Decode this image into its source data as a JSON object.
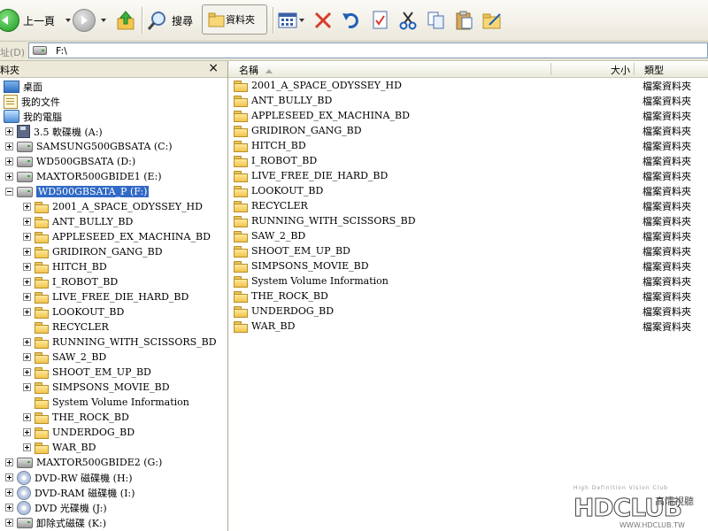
{
  "toolbar": {
    "back_label": "上一頁",
    "search_label": "搜尋",
    "folders_label": "資料夾"
  },
  "address": {
    "label": "址(D)",
    "value": "F:\\"
  },
  "folder_pane": {
    "title": "料夾",
    "close": "×",
    "items": [
      {
        "label": "桌面",
        "icon": "desktop-icon",
        "expander": "none"
      },
      {
        "label": "我的文件",
        "icon": "my-documents-icon",
        "expander": "none"
      },
      {
        "label": "我的電腦",
        "icon": "my-computer-icon",
        "expander": "none"
      },
      {
        "label": "3.5 軟碟機 (A:)",
        "icon": "floppy-drive-icon",
        "expander": "plus"
      },
      {
        "label": "SAMSUNG500GBSATA (C:)",
        "icon": "hard-drive-icon",
        "expander": "plus"
      },
      {
        "label": "WD500GBSATA (D:)",
        "icon": "hard-drive-icon",
        "expander": "plus"
      },
      {
        "label": "MAXTOR500GBIDE1 (E:)",
        "icon": "hard-drive-icon",
        "expander": "plus"
      },
      {
        "label": "WD500GBSATA_P (F:)",
        "icon": "hard-drive-icon",
        "expander": "minus",
        "selected": true
      },
      {
        "label": "2001_A_SPACE_ODYSSEY_HD",
        "icon": "folder-icon",
        "expander": "plus"
      },
      {
        "label": "ANT_BULLY_BD",
        "icon": "folder-icon",
        "expander": "plus"
      },
      {
        "label": "APPLESEED_EX_MACHINA_BD",
        "icon": "folder-icon",
        "expander": "plus"
      },
      {
        "label": "GRIDIRON_GANG_BD",
        "icon": "folder-icon",
        "expander": "plus"
      },
      {
        "label": "HITCH_BD",
        "icon": "folder-icon",
        "expander": "plus"
      },
      {
        "label": "I_ROBOT_BD",
        "icon": "folder-icon",
        "expander": "plus"
      },
      {
        "label": "LIVE_FREE_DIE_HARD_BD",
        "icon": "folder-icon",
        "expander": "plus"
      },
      {
        "label": "LOOKOUT_BD",
        "icon": "folder-icon",
        "expander": "plus"
      },
      {
        "label": "RECYCLER",
        "icon": "folder-icon",
        "expander": "none"
      },
      {
        "label": "RUNNING_WITH_SCISSORS_BD",
        "icon": "folder-icon",
        "expander": "plus"
      },
      {
        "label": "SAW_2_BD",
        "icon": "folder-icon",
        "expander": "plus"
      },
      {
        "label": "SHOOT_EM_UP_BD",
        "icon": "folder-icon",
        "expander": "plus"
      },
      {
        "label": "SIMPSONS_MOVIE_BD",
        "icon": "folder-icon",
        "expander": "plus"
      },
      {
        "label": "System Volume Information",
        "icon": "folder-icon",
        "expander": "none"
      },
      {
        "label": "THE_ROCK_BD",
        "icon": "folder-icon",
        "expander": "plus"
      },
      {
        "label": "UNDERDOG_BD",
        "icon": "folder-icon",
        "expander": "plus"
      },
      {
        "label": "WAR_BD",
        "icon": "folder-icon",
        "expander": "plus"
      },
      {
        "label": "MAXTOR500GBIDE2 (G:)",
        "icon": "hard-drive-icon",
        "expander": "plus"
      },
      {
        "label": "DVD-RW 磁碟機 (H:)",
        "icon": "dvd-drive-icon",
        "expander": "plus"
      },
      {
        "label": "DVD-RAM 磁碟機 (I:)",
        "icon": "dvd-drive-icon",
        "expander": "plus"
      },
      {
        "label": "DVD 光碟機 (J:)",
        "icon": "dvd-drive-icon",
        "expander": "plus"
      },
      {
        "label": "卸除式磁碟 (K:)",
        "icon": "removable-drive-icon",
        "expander": "plus"
      }
    ]
  },
  "file_list": {
    "columns": {
      "name": "名稱",
      "size": "大小",
      "type": "類型"
    },
    "rows": [
      {
        "name": "2001_A_SPACE_ODYSSEY_HD",
        "type": "檔案資料夾"
      },
      {
        "name": "ANT_BULLY_BD",
        "type": "檔案資料夾"
      },
      {
        "name": "APPLESEED_EX_MACHINA_BD",
        "type": "檔案資料夾"
      },
      {
        "name": "GRIDIRON_GANG_BD",
        "type": "檔案資料夾"
      },
      {
        "name": "HITCH_BD",
        "type": "檔案資料夾"
      },
      {
        "name": "I_ROBOT_BD",
        "type": "檔案資料夾"
      },
      {
        "name": "LIVE_FREE_DIE_HARD_BD",
        "type": "檔案資料夾"
      },
      {
        "name": "LOOKOUT_BD",
        "type": "檔案資料夾"
      },
      {
        "name": "RECYCLER",
        "type": "檔案資料夾"
      },
      {
        "name": "RUNNING_WITH_SCISSORS_BD",
        "type": "檔案資料夾"
      },
      {
        "name": "SAW_2_BD",
        "type": "檔案資料夾"
      },
      {
        "name": "SHOOT_EM_UP_BD",
        "type": "檔案資料夾"
      },
      {
        "name": "SIMPSONS_MOVIE_BD",
        "type": "檔案資料夾"
      },
      {
        "name": "System Volume Information",
        "type": "檔案資料夾"
      },
      {
        "name": "THE_ROCK_BD",
        "type": "檔案資料夾"
      },
      {
        "name": "UNDERDOG_BD",
        "type": "檔案資料夾"
      },
      {
        "name": "WAR_BD",
        "type": "檔案資料夾"
      }
    ]
  },
  "watermark": {
    "tagline": "High Definition Vision Club",
    "logo": "HDCLUB",
    "chinese": "高清視聽",
    "url": "WWW.HDCLUB.TW"
  },
  "colors": {
    "selection": "#316ac5",
    "folder": "#f1c54e",
    "delete_red": "#d83c2a",
    "undo_blue": "#1e5fb8"
  }
}
